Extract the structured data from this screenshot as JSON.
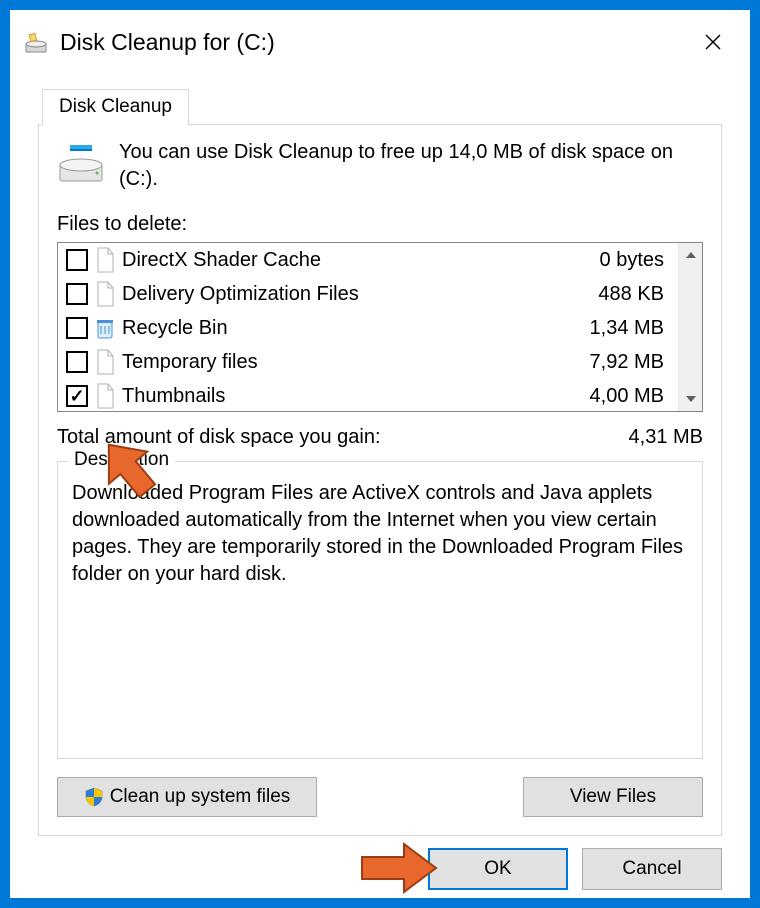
{
  "window": {
    "title": "Disk Cleanup for  (C:)"
  },
  "tab": {
    "label": "Disk Cleanup"
  },
  "intro": "You can use Disk Cleanup to free up 14,0 MB of disk space on  (C:).",
  "files_label": "Files to delete:",
  "files": [
    {
      "name": "DirectX Shader Cache",
      "size": "0 bytes",
      "checked": false,
      "icon": "file"
    },
    {
      "name": "Delivery Optimization Files",
      "size": "488 KB",
      "checked": false,
      "icon": "file"
    },
    {
      "name": "Recycle Bin",
      "size": "1,34 MB",
      "checked": false,
      "icon": "recycle"
    },
    {
      "name": "Temporary files",
      "size": "7,92 MB",
      "checked": false,
      "icon": "file"
    },
    {
      "name": "Thumbnails",
      "size": "4,00 MB",
      "checked": true,
      "icon": "file"
    }
  ],
  "total": {
    "label": "Total amount of disk space you gain:",
    "value": "4,31 MB"
  },
  "description": {
    "label": "Description",
    "text": "Downloaded Program Files are ActiveX controls and Java applets downloaded automatically from the Internet when you view certain pages. They are temporarily stored in the Downloaded Program Files folder on your hard disk."
  },
  "buttons": {
    "cleanup_system": "Clean up system files",
    "view_files": "View Files",
    "ok": "OK",
    "cancel": "Cancel"
  }
}
